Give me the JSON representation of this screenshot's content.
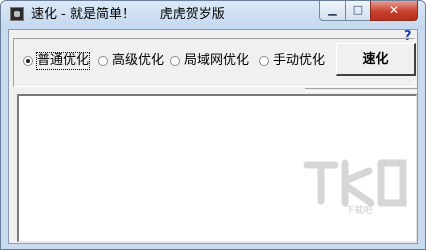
{
  "window": {
    "title": "速化 - 就是简单！      虎虎贺岁版",
    "minimize_glyph": "▁",
    "maximize_glyph": "□",
    "close_glyph": "✕"
  },
  "help": {
    "label": "?"
  },
  "options": [
    {
      "label": "普通优化",
      "checked": true
    },
    {
      "label": "高级优化",
      "checked": false
    },
    {
      "label": "局域网优化",
      "checked": false
    },
    {
      "label": "手动优化",
      "checked": false
    }
  ],
  "speed_button": {
    "label": "速化"
  },
  "watermark": {
    "text": "下载吧"
  },
  "colors": {
    "frame": "#c9dbef",
    "client": "#f0f0f0",
    "close": "#c7402c"
  },
  "icons": [
    "app-icon",
    "help-icon",
    "minimize-icon",
    "maximize-icon",
    "close-icon",
    "watermark-logo"
  ]
}
